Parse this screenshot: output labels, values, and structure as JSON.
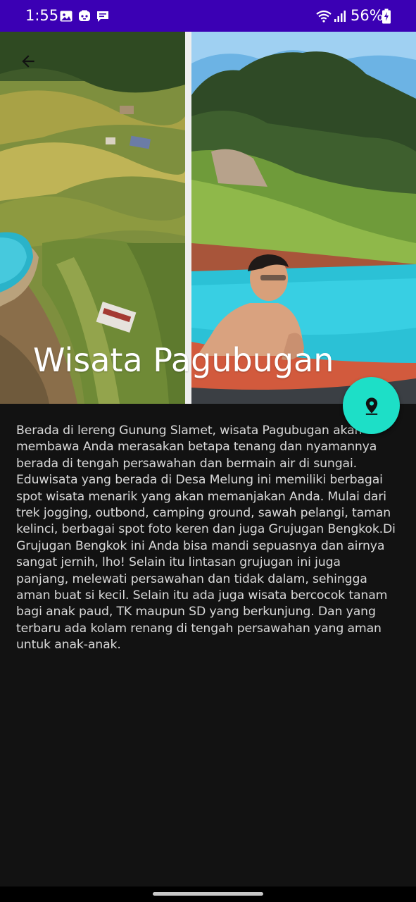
{
  "status_bar": {
    "time": "1:55",
    "battery": "56%",
    "background_color": "#3b00b4",
    "icons": [
      "image-icon",
      "game-icon",
      "message-icon",
      "wifi-icon",
      "signal-icon",
      "battery-icon"
    ]
  },
  "toolbar": {
    "back_icon": "arrow-back-icon"
  },
  "hero": {
    "title": "Wisata Pagubugan"
  },
  "fab": {
    "icon": "location-pin-icon",
    "color": "#1ddfc7"
  },
  "content": {
    "description": "Berada di lereng Gunung Slamet, wisata Pagubugan akan membawa Anda merasakan betapa tenang dan nyamannya berada di tengah persawahan dan bermain air di sungai. Eduwisata yang berada di Desa Melung ini memiliki berbagai spot wisata menarik yang akan memanjakan Anda. Mulai dari trek jogging, outbond, camping ground, sawah pelangi, taman kelinci, berbagai spot foto keren dan juga Grujugan Bengkok.Di Grujugan Bengkok ini Anda bisa mandi sepuasnya dan airnya sangat jernih, lho! Selain itu lintasan grujugan ini juga panjang, melewati persawahan dan tidak dalam, sehingga aman buat si kecil. Selain itu ada juga wisata bercocok tanam bagi anak paud, TK maupun SD yang berkunjung. Dan yang terbaru ada kolam renang di tengah persawahan yang aman untuk anak-anak."
  },
  "theme": {
    "background": "#121212",
    "text": "#d9d9d9"
  }
}
